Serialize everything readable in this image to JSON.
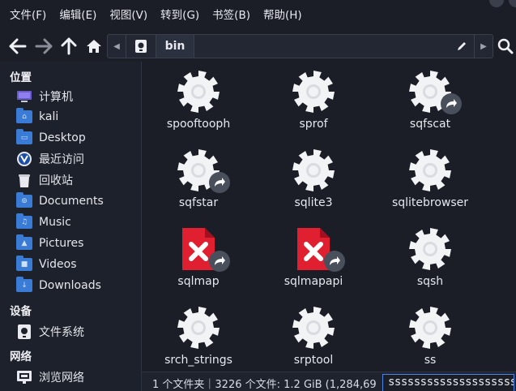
{
  "menubar": {
    "items": [
      "文件(F)",
      "编辑(E)",
      "视图(V)",
      "转到(G)",
      "书签(B)",
      "帮助(H)"
    ]
  },
  "toolbar": {
    "back_icon": "arrow-left-icon",
    "forward_icon": "arrow-right-icon",
    "up_icon": "arrow-up-icon",
    "home_icon": "home-icon",
    "path_current": "bin",
    "edit_icon": "pencil-icon",
    "search_icon": "search-icon"
  },
  "sidebar": {
    "places_header": "位置",
    "places": [
      {
        "label": "计算机",
        "icon": "computer-icon"
      },
      {
        "label": "kali",
        "icon": "home-folder-icon"
      },
      {
        "label": "Desktop",
        "icon": "desktop-folder-icon"
      },
      {
        "label": "最近访问",
        "icon": "recent-icon"
      },
      {
        "label": "回收站",
        "icon": "trash-icon"
      },
      {
        "label": "Documents",
        "icon": "documents-folder-icon"
      },
      {
        "label": "Music",
        "icon": "music-folder-icon"
      },
      {
        "label": "Pictures",
        "icon": "pictures-folder-icon"
      },
      {
        "label": "Videos",
        "icon": "videos-folder-icon"
      },
      {
        "label": "Downloads",
        "icon": "downloads-folder-icon"
      }
    ],
    "devices_header": "设备",
    "devices": [
      {
        "label": "文件系统",
        "icon": "drive-icon"
      }
    ],
    "network_header": "网络",
    "network": [
      {
        "label": "浏览网络",
        "icon": "network-icon"
      }
    ]
  },
  "files": [
    {
      "name": "spooftooph",
      "type": "executable",
      "link": false
    },
    {
      "name": "sprof",
      "type": "executable",
      "link": false
    },
    {
      "name": "sqfscat",
      "type": "executable",
      "link": true
    },
    {
      "name": "sqfstar",
      "type": "executable",
      "link": true
    },
    {
      "name": "sqlite3",
      "type": "executable",
      "link": false
    },
    {
      "name": "sqlitebrowser",
      "type": "executable",
      "link": false
    },
    {
      "name": "sqlmap",
      "type": "broken",
      "link": true
    },
    {
      "name": "sqlmapapi",
      "type": "broken",
      "link": true
    },
    {
      "name": "sqsh",
      "type": "executable",
      "link": false
    },
    {
      "name": "srch_strings",
      "type": "executable",
      "link": false
    },
    {
      "name": "srptool",
      "type": "executable",
      "link": false
    },
    {
      "name": "ss",
      "type": "executable",
      "link": false
    }
  ],
  "statusbar": {
    "text": "1 个文件夹｜3226 个文件: 1.2 GiB (1,284,69",
    "search_value": "ssssssssssssssssssssss"
  },
  "colors": {
    "background": "#1b1e27",
    "sidebar": "#1d212b",
    "accent": "#4a86e8",
    "broken_red": "#e02030"
  }
}
